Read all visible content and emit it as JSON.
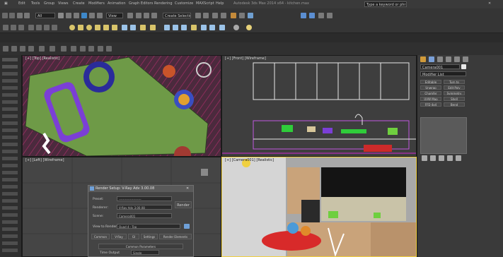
{
  "menubar": {
    "items": [
      "Edit",
      "Tools",
      "Group",
      "Views",
      "Create",
      "Modifiers",
      "Animation",
      "Graph Editors",
      "Rendering",
      "Customize",
      "MAXScript",
      "Help"
    ],
    "title": "Autodesk 3ds Max 2014 x64 - kitchen.max",
    "search_placeholder": "Type a keyword or phrase"
  },
  "toolbar": {
    "selection_filter": "All",
    "named_selection": "Create Selection Se",
    "view_combo": "View"
  },
  "viewports": {
    "top_left": {
      "label": "[+] [Top] [Realistic]"
    },
    "top_right": {
      "label": "[+] [Front] [Wireframe]"
    },
    "bottom_left": {
      "label": "[+] [Left] [Wireframe]"
    },
    "bottom_right": {
      "label": "[+] [Camera001] [Realistic]"
    }
  },
  "command_panel": {
    "object_name": "Camera001",
    "modifier_list": "Modifier List",
    "buttons": [
      "Editable",
      "Turn to",
      "Unwrap",
      "Edit Poly",
      "Chamfer",
      "Symmetry",
      "UVW Map",
      "Shell",
      "FFD 4x4",
      "Bend"
    ]
  },
  "dialog": {
    "title": "Render Setup: V-Ray Adv 3.00.08",
    "rows": [
      {
        "label": "Preset:",
        "value": "----------------------"
      },
      {
        "label": "Renderer:",
        "value": "V-Ray Adv 3.00.08"
      },
      {
        "label": "Scene:",
        "value": "Camera001"
      }
    ],
    "render_button": "Render",
    "view_to_render_label": "View to Render:",
    "view_to_render_value": "Quad 4 - Top",
    "tabs": [
      "Common",
      "V-Ray",
      "GI",
      "Settings",
      "Render Elements"
    ],
    "section_header": "Common Parameters",
    "sub_label": "Time Output",
    "sub_value": "Single"
  },
  "colors": {
    "bg": "#2b2b2b",
    "grass": "#6e9a47",
    "floor_red": "#b21e2a",
    "purple": "#7b3fd6",
    "wall_gray": "#9a9a9a",
    "cabinet_wood": "#c9a37a"
  },
  "icons": [
    "select-icon",
    "move-icon",
    "rotate-icon",
    "scale-icon",
    "render-icon",
    "material-icon",
    "snap-icon",
    "undo-icon",
    "redo-icon",
    "link-icon"
  ]
}
